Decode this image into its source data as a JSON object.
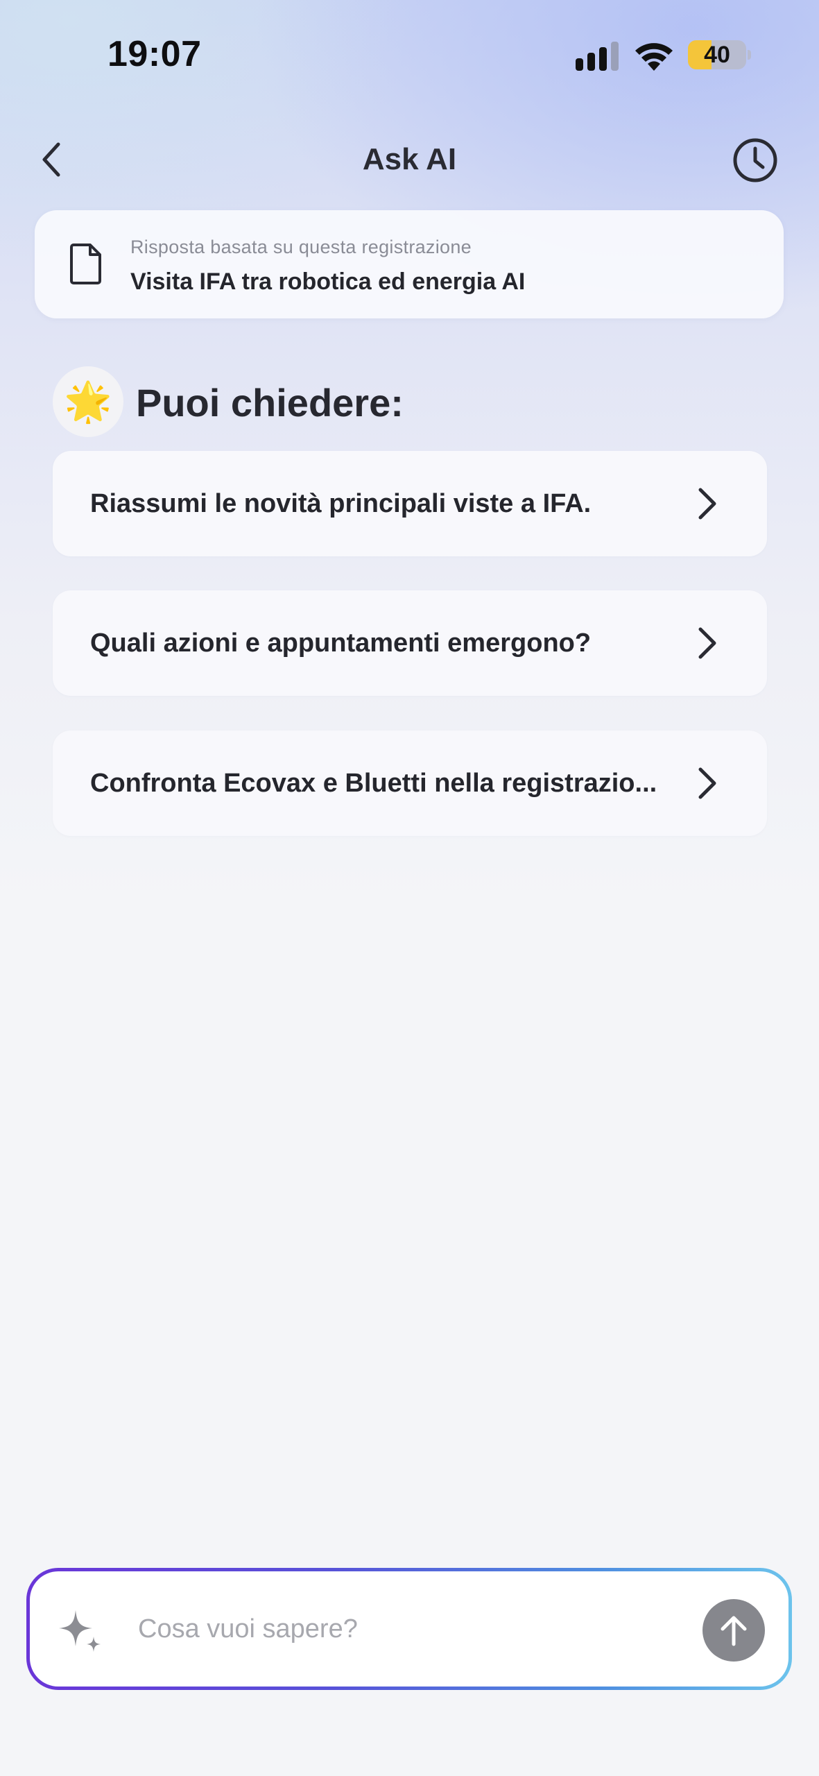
{
  "status_bar": {
    "time": "19:07",
    "battery_percent": "40",
    "battery_level": 0.4,
    "battery_color": "#f4c53a"
  },
  "nav": {
    "title": "Ask AI",
    "back_icon": "chevron-left-icon",
    "history_icon": "clock-icon"
  },
  "source": {
    "label": "Risposta basata su questa registrazione",
    "title": "Visita IFA tra robotica ed energia AI",
    "icon": "document-icon"
  },
  "suggestions": {
    "emoji": "🌟",
    "title": "Puoi chiedere:",
    "items": [
      {
        "label": "Riassumi le novità principali viste a IFA."
      },
      {
        "label": "Quali azioni e appuntamenti emergono?"
      },
      {
        "label": "Confronta Ecovax e Bluetti nella registrazio..."
      }
    ]
  },
  "input": {
    "placeholder": "Cosa vuoi sapere?",
    "value": "",
    "gradient_start": "#6a36d8",
    "gradient_end": "#6cc3ec",
    "send_icon": "arrow-up-icon",
    "sparkle_icon": "sparkle-icon"
  }
}
